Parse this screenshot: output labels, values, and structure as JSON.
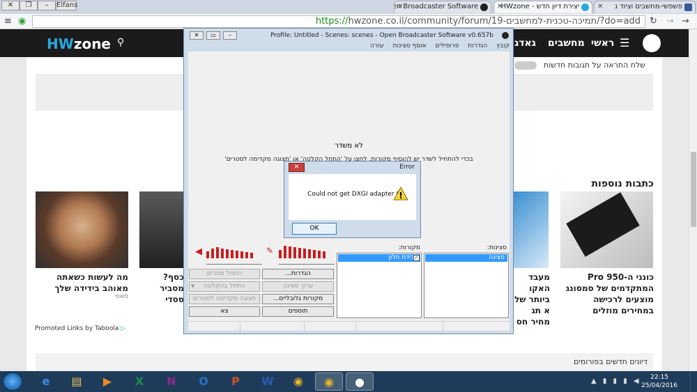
{
  "tabs": [
    {
      "title": "פשפשי-מחשבים וציוד נ",
      "favicon_color": "#3b5998"
    },
    {
      "title": "יצירת דיון חדש - HWzone",
      "favicon_color": "#2aa8e0"
    },
    {
      "title": "Open Broadcaster Software",
      "favicon_color": "#222222"
    }
  ],
  "window_user": "Elfans",
  "address": {
    "https": "https://",
    "rest": "hwzone.co.il/community/forum/19-תמיכה-טכנית-למחשבים/?do=add"
  },
  "site": {
    "logo_hw": "HW",
    "logo_zone": "zone",
    "nav": [
      "ראשי",
      "מחשבים",
      "גאדג"
    ],
    "notify_text": "שלח התראה על תגובות חדשות",
    "more_articles": "כתבות נוספות",
    "cards": [
      {
        "title": "כונני ה-950 Pro המתקדמים של סמסונג מוצעים לרכישה במחירים מוזלים"
      },
      {
        "title": "מעבד האקו ביותר של א תג מחיר חס"
      },
      {
        "title": "כסף? מסביר ססדי"
      },
      {
        "title": "מה לעשות כשאתה מאוהב בידידה שלך",
        "source": "מאפי"
      }
    ],
    "taboola": "Promoted Links by Taboola",
    "forums_label": "דיונים חדשים בפורומים"
  },
  "obs": {
    "title": "Profile: Untitled - Scenes: scenes - Open Broadcaster Software v0.657b",
    "menu": [
      "קובץ",
      "הגדרות",
      "פרופילים",
      "אוסף סצינות",
      "עזרה"
    ],
    "no_source": "לא משדר",
    "hint": "בכדי להתחיל לשדר יש להוסיף מקורות, לחצו על 'התחל הקלטה' או 'תצוגה מקדימה לסטרים'",
    "scenes_label": "סצינות:",
    "sources_label": "מקורות:",
    "scene_item": "סצינה",
    "source_item": "לכידת חלון",
    "buttons": {
      "settings": "הגדרות...",
      "start_stream": "התחל סטרים",
      "edit_scene": "ערוך סצינה",
      "start_record": "התחל בהקלטה",
      "global_sources": "מקורות גלובליים...",
      "preview_stream": "תצוגה מקדימה לסטרים",
      "plugins": "תוספים",
      "exit": "צא"
    },
    "meter_left": [
      10,
      14,
      16,
      14,
      13,
      12,
      11,
      10,
      9,
      8
    ],
    "meter_right": [
      12,
      18,
      17,
      16,
      15,
      14,
      13,
      12,
      11,
      10
    ]
  },
  "error": {
    "title": "Error",
    "message": "Could not get DXGI adapter 0",
    "ok": "OK"
  },
  "taskbar": {
    "time": "22:15",
    "date": "25/04/2016"
  }
}
